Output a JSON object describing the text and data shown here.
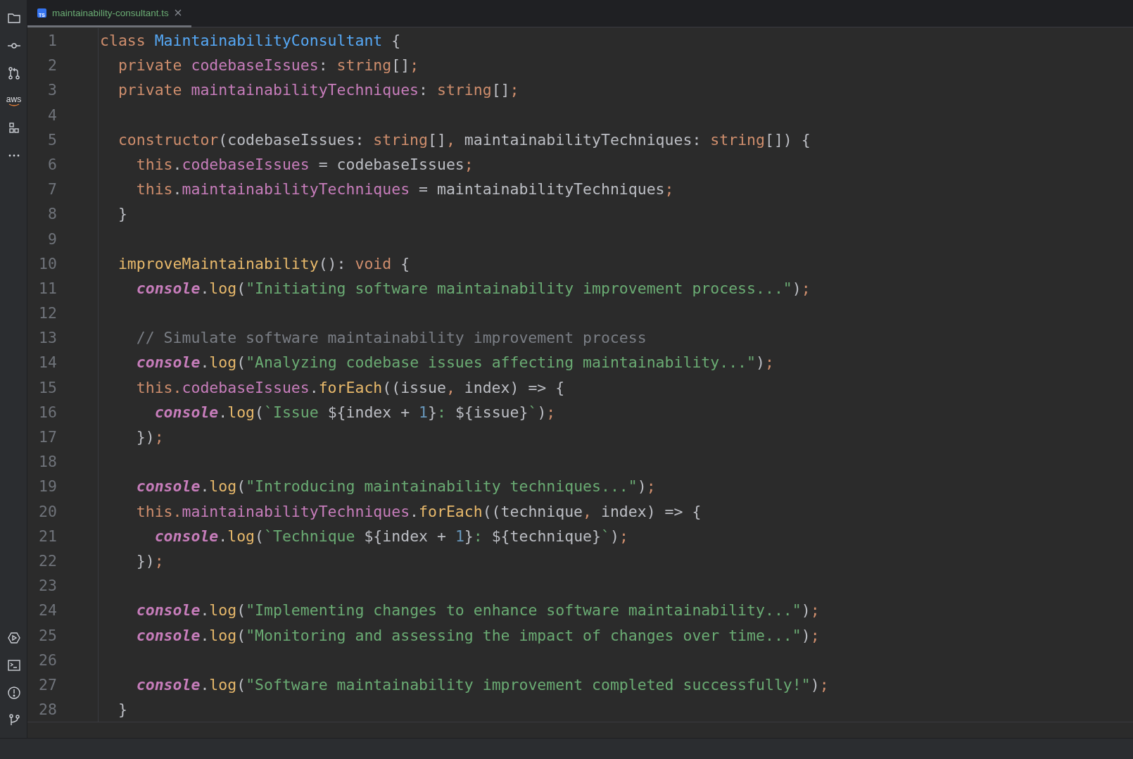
{
  "tab": {
    "file_badge": "TS",
    "label": "maintainability-consultant.ts",
    "selected": true
  },
  "sidebar": {
    "aws_label": "aws"
  },
  "lines": [
    {
      "number": "1",
      "tokens": [
        {
          "kind": "keyword",
          "text": "class "
        },
        {
          "kind": "classname",
          "text": "MaintainabilityConsultant"
        },
        {
          "kind": "plain",
          "text": " {"
        }
      ]
    },
    {
      "number": "2",
      "tokens": [
        {
          "kind": "keyword",
          "text": "  private "
        },
        {
          "kind": "field",
          "text": "codebaseIssues"
        },
        {
          "kind": "plain",
          "text": ": "
        },
        {
          "kind": "keyword",
          "text": "string"
        },
        {
          "kind": "plain",
          "text": "[]"
        },
        {
          "kind": "punct",
          "text": ";"
        }
      ]
    },
    {
      "number": "3",
      "tokens": [
        {
          "kind": "keyword",
          "text": "  private "
        },
        {
          "kind": "field",
          "text": "maintainabilityTechniques"
        },
        {
          "kind": "plain",
          "text": ": "
        },
        {
          "kind": "keyword",
          "text": "string"
        },
        {
          "kind": "plain",
          "text": "[]"
        },
        {
          "kind": "punct",
          "text": ";"
        }
      ]
    },
    {
      "number": "4"
    },
    {
      "number": "5",
      "tokens": [
        {
          "kind": "keyword",
          "text": "  constructor"
        },
        {
          "kind": "plain",
          "text": "(codebaseIssues: "
        },
        {
          "kind": "keyword",
          "text": "string"
        },
        {
          "kind": "plain",
          "text": "[]"
        },
        {
          "kind": "punct",
          "text": ", "
        },
        {
          "kind": "plain",
          "text": "maintainabilityTechniques: "
        },
        {
          "kind": "keyword",
          "text": "string"
        },
        {
          "kind": "plain",
          "text": "[]) {"
        }
      ]
    },
    {
      "number": "6",
      "tokens": [
        {
          "kind": "keyword",
          "text": "    this"
        },
        {
          "kind": "plain",
          "text": "."
        },
        {
          "kind": "field",
          "text": "codebaseIssues"
        },
        {
          "kind": "plain",
          "text": " = codebaseIssues"
        },
        {
          "kind": "punct",
          "text": ";"
        }
      ]
    },
    {
      "number": "7",
      "tokens": [
        {
          "kind": "keyword",
          "text": "    this"
        },
        {
          "kind": "plain",
          "text": "."
        },
        {
          "kind": "field",
          "text": "maintainabilityTechniques"
        },
        {
          "kind": "plain",
          "text": " = maintainabilityTechniques"
        },
        {
          "kind": "punct",
          "text": ";"
        }
      ]
    },
    {
      "number": "8",
      "tokens": [
        {
          "kind": "plain",
          "text": "  }"
        }
      ]
    },
    {
      "number": "9"
    },
    {
      "number": "10",
      "tokens": [
        {
          "kind": "method",
          "text": "  improveMaintainability"
        },
        {
          "kind": "plain",
          "text": "(): "
        },
        {
          "kind": "keyword",
          "text": "void"
        },
        {
          "kind": "plain",
          "text": " {"
        }
      ]
    },
    {
      "number": "11",
      "tokens": [
        {
          "kind": "global",
          "text": "    console"
        },
        {
          "kind": "plain",
          "text": "."
        },
        {
          "kind": "method",
          "text": "log"
        },
        {
          "kind": "plain",
          "text": "("
        },
        {
          "kind": "string",
          "text": "\"Initiating software maintainability improvement process...\""
        },
        {
          "kind": "plain",
          "text": ")"
        },
        {
          "kind": "punct",
          "text": ";"
        }
      ]
    },
    {
      "number": "12"
    },
    {
      "number": "13",
      "tokens": [
        {
          "kind": "comment",
          "text": "    // Simulate software maintainability improvement process"
        }
      ]
    },
    {
      "number": "14",
      "tokens": [
        {
          "kind": "global",
          "text": "    console"
        },
        {
          "kind": "plain",
          "text": "."
        },
        {
          "kind": "method",
          "text": "log"
        },
        {
          "kind": "plain",
          "text": "("
        },
        {
          "kind": "string",
          "text": "\"Analyzing codebase issues affecting maintainability...\""
        },
        {
          "kind": "plain",
          "text": ")"
        },
        {
          "kind": "punct",
          "text": ";"
        }
      ]
    },
    {
      "number": "15",
      "tokens": [
        {
          "kind": "keyword",
          "text": "    this."
        },
        {
          "kind": "field",
          "text": "codebaseIssues"
        },
        {
          "kind": "plain",
          "text": "."
        },
        {
          "kind": "method",
          "text": "forEach"
        },
        {
          "kind": "plain",
          "text": "((issue"
        },
        {
          "kind": "punct",
          "text": ", "
        },
        {
          "kind": "plain",
          "text": "index) => {"
        }
      ]
    },
    {
      "number": "16",
      "tokens": [
        {
          "kind": "global",
          "text": "      console"
        },
        {
          "kind": "plain",
          "text": "."
        },
        {
          "kind": "method",
          "text": "log"
        },
        {
          "kind": "plain",
          "text": "("
        },
        {
          "kind": "string",
          "text": "`Issue "
        },
        {
          "kind": "plain",
          "text": "${index + "
        },
        {
          "kind": "number",
          "text": "1"
        },
        {
          "kind": "plain",
          "text": "}"
        },
        {
          "kind": "string",
          "text": ": "
        },
        {
          "kind": "plain",
          "text": "${issue}"
        },
        {
          "kind": "string",
          "text": "`"
        },
        {
          "kind": "plain",
          "text": ")"
        },
        {
          "kind": "punct",
          "text": ";"
        }
      ]
    },
    {
      "number": "17",
      "tokens": [
        {
          "kind": "plain",
          "text": "    })"
        },
        {
          "kind": "punct",
          "text": ";"
        }
      ]
    },
    {
      "number": "18"
    },
    {
      "number": "19",
      "tokens": [
        {
          "kind": "global",
          "text": "    console"
        },
        {
          "kind": "plain",
          "text": "."
        },
        {
          "kind": "method",
          "text": "log"
        },
        {
          "kind": "plain",
          "text": "("
        },
        {
          "kind": "string",
          "text": "\"Introducing maintainability techniques...\""
        },
        {
          "kind": "plain",
          "text": ")"
        },
        {
          "kind": "punct",
          "text": ";"
        }
      ]
    },
    {
      "number": "20",
      "tokens": [
        {
          "kind": "keyword",
          "text": "    this."
        },
        {
          "kind": "field",
          "text": "maintainabilityTechniques"
        },
        {
          "kind": "plain",
          "text": "."
        },
        {
          "kind": "method",
          "text": "forEach"
        },
        {
          "kind": "plain",
          "text": "((technique"
        },
        {
          "kind": "punct",
          "text": ", "
        },
        {
          "kind": "plain",
          "text": "index) => {"
        }
      ]
    },
    {
      "number": "21",
      "tokens": [
        {
          "kind": "global",
          "text": "      console"
        },
        {
          "kind": "plain",
          "text": "."
        },
        {
          "kind": "method",
          "text": "log"
        },
        {
          "kind": "plain",
          "text": "("
        },
        {
          "kind": "string",
          "text": "`Technique "
        },
        {
          "kind": "plain",
          "text": "${index + "
        },
        {
          "kind": "number",
          "text": "1"
        },
        {
          "kind": "plain",
          "text": "}"
        },
        {
          "kind": "string",
          "text": ": "
        },
        {
          "kind": "plain",
          "text": "${technique}"
        },
        {
          "kind": "string",
          "text": "`"
        },
        {
          "kind": "plain",
          "text": ")"
        },
        {
          "kind": "punct",
          "text": ";"
        }
      ]
    },
    {
      "number": "22",
      "tokens": [
        {
          "kind": "plain",
          "text": "    })"
        },
        {
          "kind": "punct",
          "text": ";"
        }
      ]
    },
    {
      "number": "23"
    },
    {
      "number": "24",
      "tokens": [
        {
          "kind": "global",
          "text": "    console"
        },
        {
          "kind": "plain",
          "text": "."
        },
        {
          "kind": "method",
          "text": "log"
        },
        {
          "kind": "plain",
          "text": "("
        },
        {
          "kind": "string",
          "text": "\"Implementing changes to enhance software maintainability...\""
        },
        {
          "kind": "plain",
          "text": ")"
        },
        {
          "kind": "punct",
          "text": ";"
        }
      ]
    },
    {
      "number": "25",
      "tokens": [
        {
          "kind": "global",
          "text": "    console"
        },
        {
          "kind": "plain",
          "text": "."
        },
        {
          "kind": "method",
          "text": "log"
        },
        {
          "kind": "plain",
          "text": "("
        },
        {
          "kind": "string",
          "text": "\"Monitoring and assessing the impact of changes over time...\""
        },
        {
          "kind": "plain",
          "text": ")"
        },
        {
          "kind": "punct",
          "text": ";"
        }
      ]
    },
    {
      "number": "26"
    },
    {
      "number": "27",
      "tokens": [
        {
          "kind": "global",
          "text": "    console"
        },
        {
          "kind": "plain",
          "text": "."
        },
        {
          "kind": "method",
          "text": "log"
        },
        {
          "kind": "plain",
          "text": "("
        },
        {
          "kind": "string",
          "text": "\"Software maintainability improvement completed successfully!\""
        },
        {
          "kind": "plain",
          "text": ")"
        },
        {
          "kind": "punct",
          "text": ";"
        }
      ]
    },
    {
      "number": "28",
      "tokens": [
        {
          "kind": "plain",
          "text": "  }"
        }
      ]
    }
  ]
}
